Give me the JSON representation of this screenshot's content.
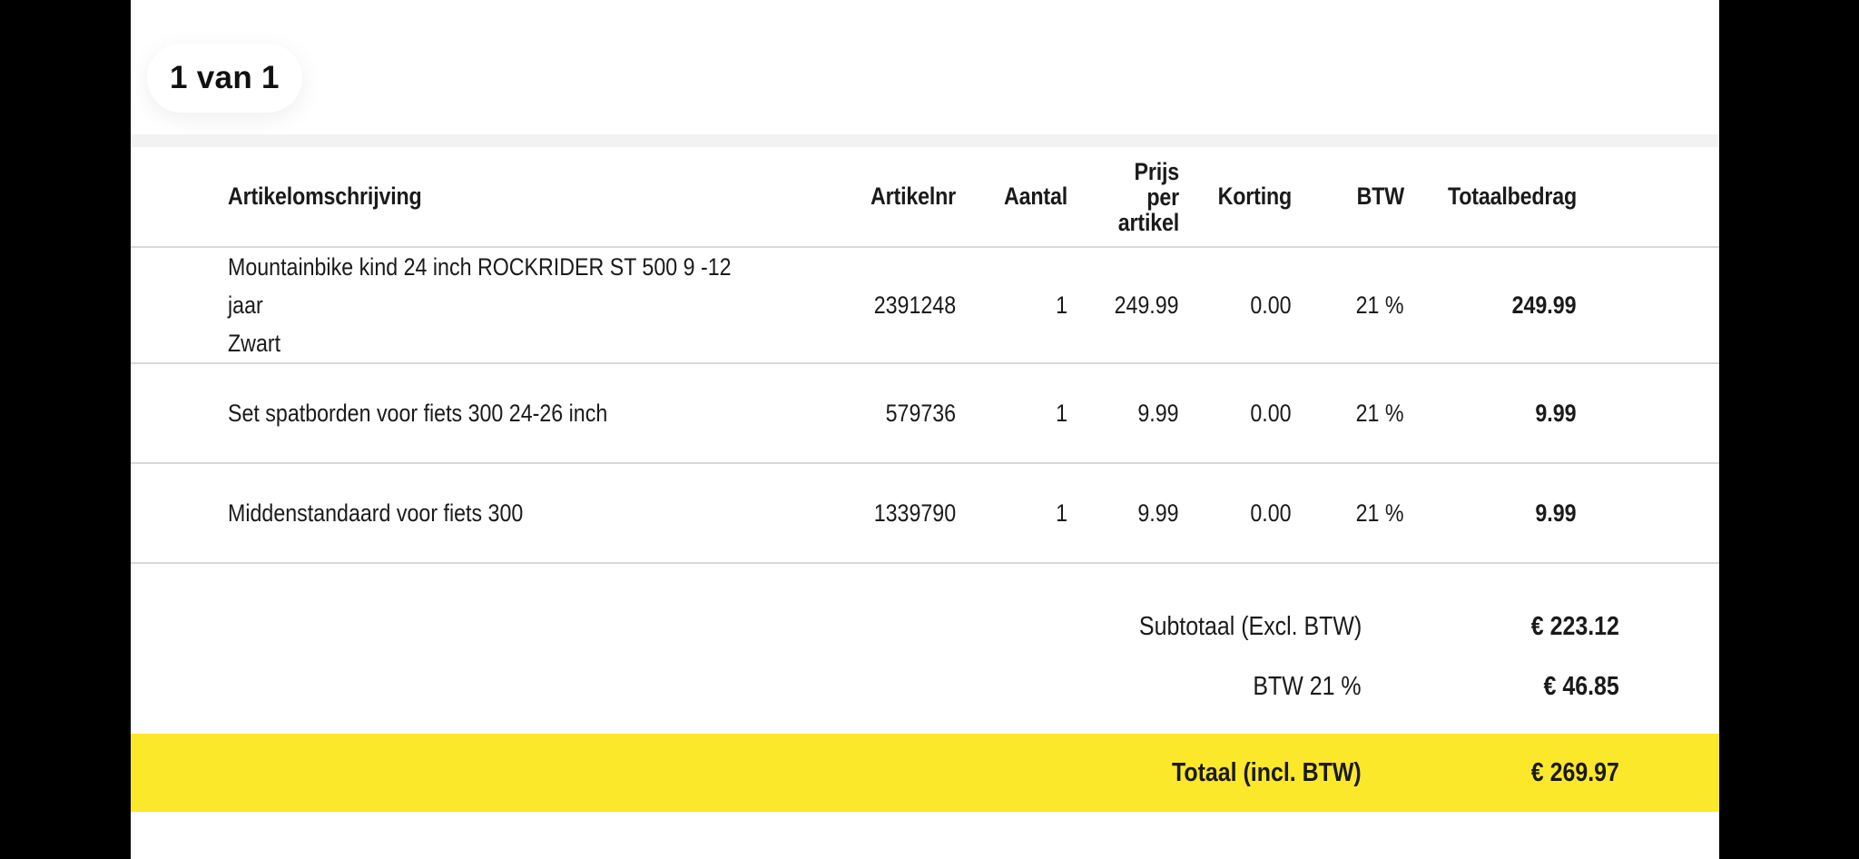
{
  "pagination": {
    "label": "1 van 1"
  },
  "table": {
    "headers": {
      "description": "Artikelomschrijving",
      "article_number": "Artikelnr",
      "quantity": "Aantal",
      "price_line1": "Prijs",
      "price_line2": "per",
      "price_line3": "artikel",
      "discount": "Korting",
      "vat": "BTW",
      "total": "Totaalbedrag"
    },
    "rows": [
      {
        "description_line1": "Mountainbike kind 24 inch ROCKRIDER ST 500 9 -12 jaar",
        "description_line2": "Zwart",
        "article_number": "2391248",
        "quantity": "1",
        "price": "249.99",
        "discount": "0.00",
        "vat": "21 %",
        "total": "249.99"
      },
      {
        "description_line1": "Set spatborden voor fiets 300 24-26 inch",
        "description_line2": "",
        "article_number": "579736",
        "quantity": "1",
        "price": "9.99",
        "discount": "0.00",
        "vat": "21 %",
        "total": "9.99"
      },
      {
        "description_line1": "Middenstandaard voor fiets 300",
        "description_line2": "",
        "article_number": "1339790",
        "quantity": "1",
        "price": "9.99",
        "discount": "0.00",
        "vat": "21 %",
        "total": "9.99"
      }
    ]
  },
  "summary": {
    "subtotal_label": "Subtotaal (Excl. BTW)",
    "subtotal_value": "€ 223.12",
    "vat_label": "BTW 21 %",
    "vat_value": "€ 46.85",
    "total_label": "Totaal (incl. BTW)",
    "total_value": "€ 269.97"
  },
  "colors": {
    "total_highlight": "#fce82a",
    "page_background": "#ffffff",
    "outer_background": "#000000"
  }
}
